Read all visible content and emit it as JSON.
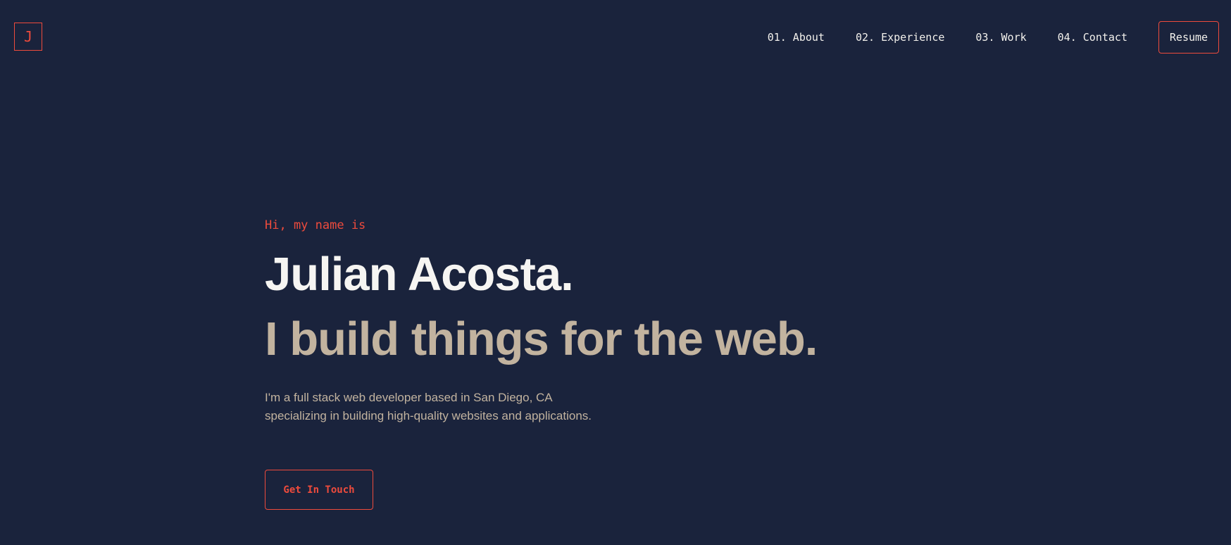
{
  "header": {
    "logo_letter": "J",
    "nav": [
      {
        "label": "01. About"
      },
      {
        "label": "02. Experience"
      },
      {
        "label": "03. Work"
      },
      {
        "label": "04. Contact"
      }
    ],
    "resume_label": "Resume"
  },
  "hero": {
    "greeting": "Hi, my name is",
    "name": "Julian Acosta.",
    "tagline": "I build things for the web.",
    "description_lines": [
      "I'm a full stack web developer based in San Diego, CA",
      "specializing in building high-quality websites and applications."
    ],
    "cta_label": "Get In Touch"
  },
  "colors": {
    "background": "#1a233c",
    "accent": "#ee4b3c",
    "heading": "#f6f5f2",
    "muted": "#c2b39f"
  }
}
